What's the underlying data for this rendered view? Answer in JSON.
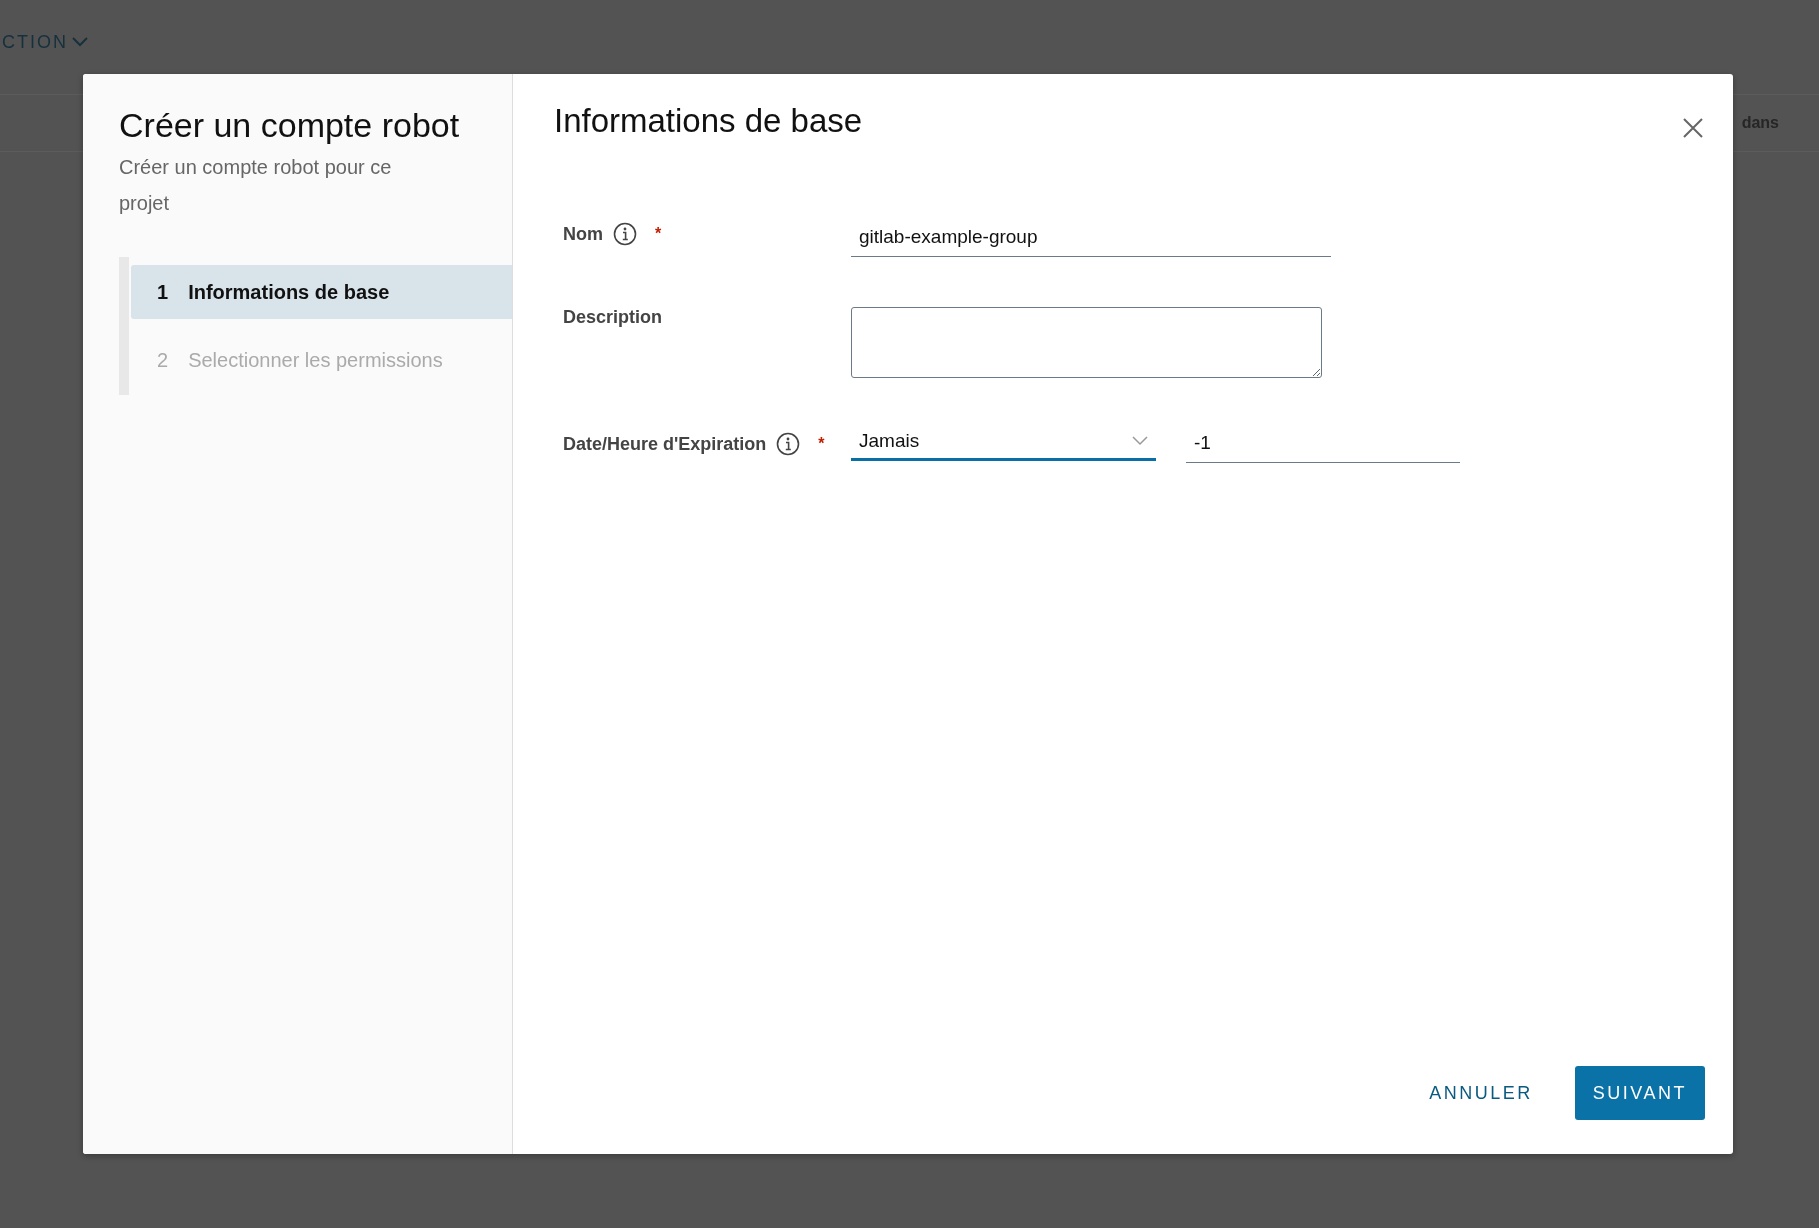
{
  "background": {
    "menu_label": "CTION",
    "column_header": "dans"
  },
  "dialog": {
    "title": "Créer un compte robot",
    "subtitle": "Créer un compte robot pour ce projet",
    "steps": [
      {
        "number": "1",
        "label": "Informations de base",
        "selected": true
      },
      {
        "number": "2",
        "label": "Selectionner les permissions",
        "selected": false
      }
    ],
    "heading": "Informations de base",
    "fields": [
      {
        "kind": "text",
        "label": "Nom",
        "info": true,
        "required_mark": "*",
        "value": "gitlab-example-group"
      },
      {
        "kind": "textarea",
        "label": "Description",
        "info": false
      },
      {
        "kind": "select-number",
        "label": "Date/Heure d'Expiration",
        "info": true,
        "required_mark": "*",
        "value": "Jamais",
        "number": "-1"
      }
    ],
    "buttons": [
      {
        "kind": "flat",
        "label": "ANNULER"
      },
      {
        "kind": "primary",
        "label": "SUIVANT"
      }
    ]
  }
}
